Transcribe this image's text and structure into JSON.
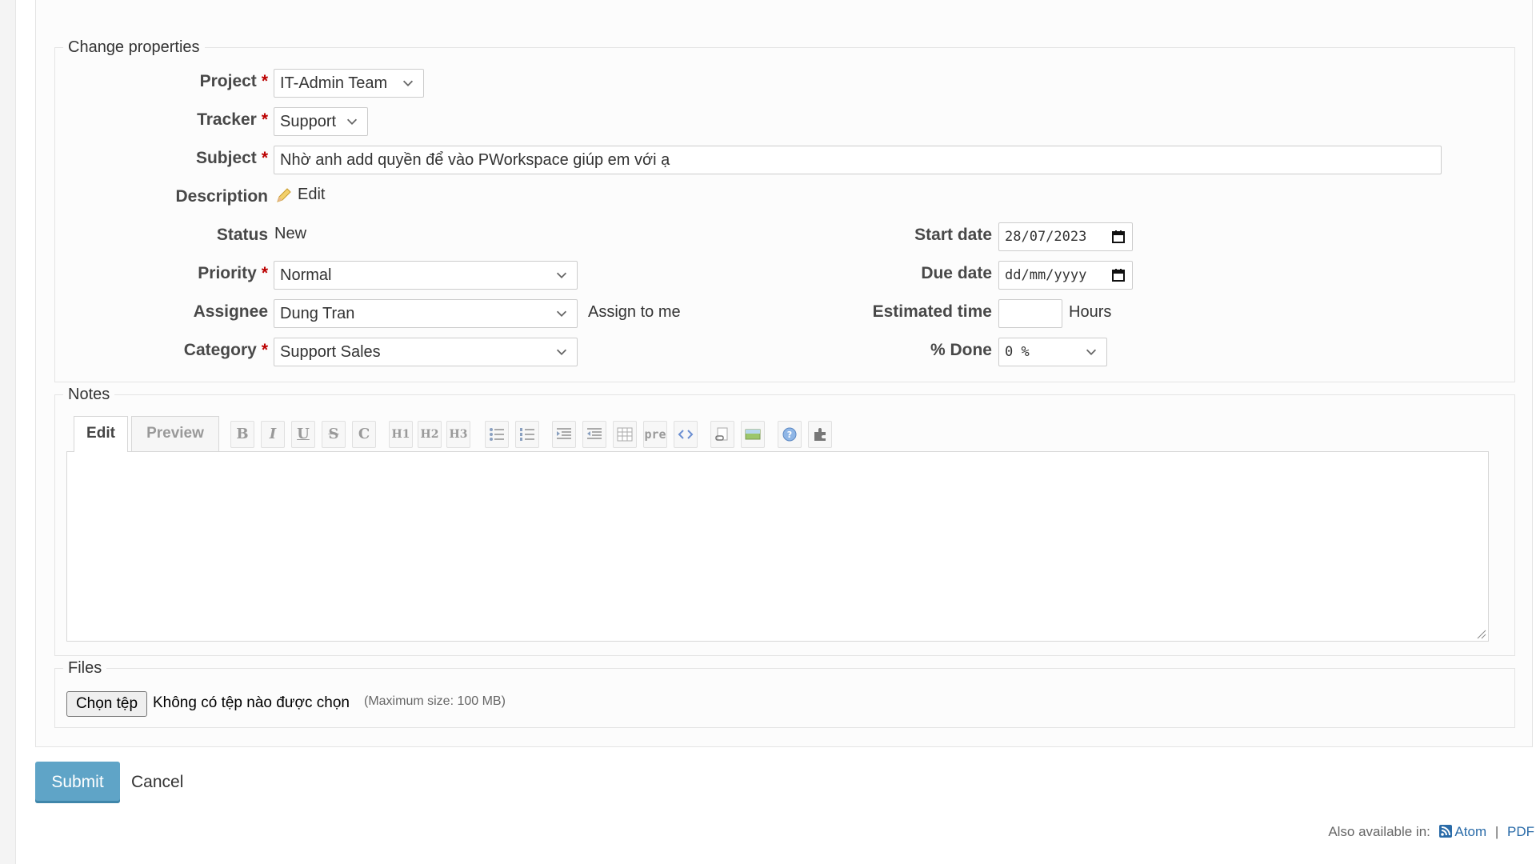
{
  "properties": {
    "legend": "Change properties",
    "project": {
      "label": "Project",
      "value": "IT-Admin Team"
    },
    "tracker": {
      "label": "Tracker",
      "value": "Support"
    },
    "subject": {
      "label": "Subject",
      "value": "Nhờ anh add quyền để vào PWorkspace giúp em với ạ"
    },
    "description": {
      "label": "Description",
      "edit_link": "Edit"
    },
    "status": {
      "label": "Status",
      "value": "New"
    },
    "priority": {
      "label": "Priority",
      "value": "Normal"
    },
    "assignee": {
      "label": "Assignee",
      "value": "Dung Tran",
      "assign_to_me": "Assign to me"
    },
    "category": {
      "label": "Category",
      "value": "Support Sales"
    },
    "start_date": {
      "label": "Start date",
      "value": "28/07/2023"
    },
    "due_date": {
      "label": "Due date",
      "placeholder": "dd/mm/yyyy"
    },
    "estimated_time": {
      "label": "Estimated time",
      "value": "",
      "unit": "Hours"
    },
    "done_ratio": {
      "label": "% Done",
      "value": "0 %"
    }
  },
  "notes": {
    "legend": "Notes",
    "tabs": [
      {
        "label": "Edit"
      },
      {
        "label": "Preview"
      }
    ],
    "toolbar": {
      "bold": "B",
      "italic": "I",
      "underline": "U",
      "strike": "S",
      "code": "C",
      "h1": "H1",
      "h2": "H2",
      "h3": "H3",
      "pre": "pre"
    }
  },
  "files": {
    "legend": "Files",
    "choose_button": "Chọn tệp",
    "no_file": "Không có tệp nào được chọn",
    "max_size": "(Maximum size: 100 MB)"
  },
  "actions": {
    "submit": "Submit",
    "cancel": "Cancel"
  },
  "footer": {
    "also_available": "Also available in:",
    "atom": "Atom",
    "separator": "|",
    "pdf": "PDF"
  }
}
